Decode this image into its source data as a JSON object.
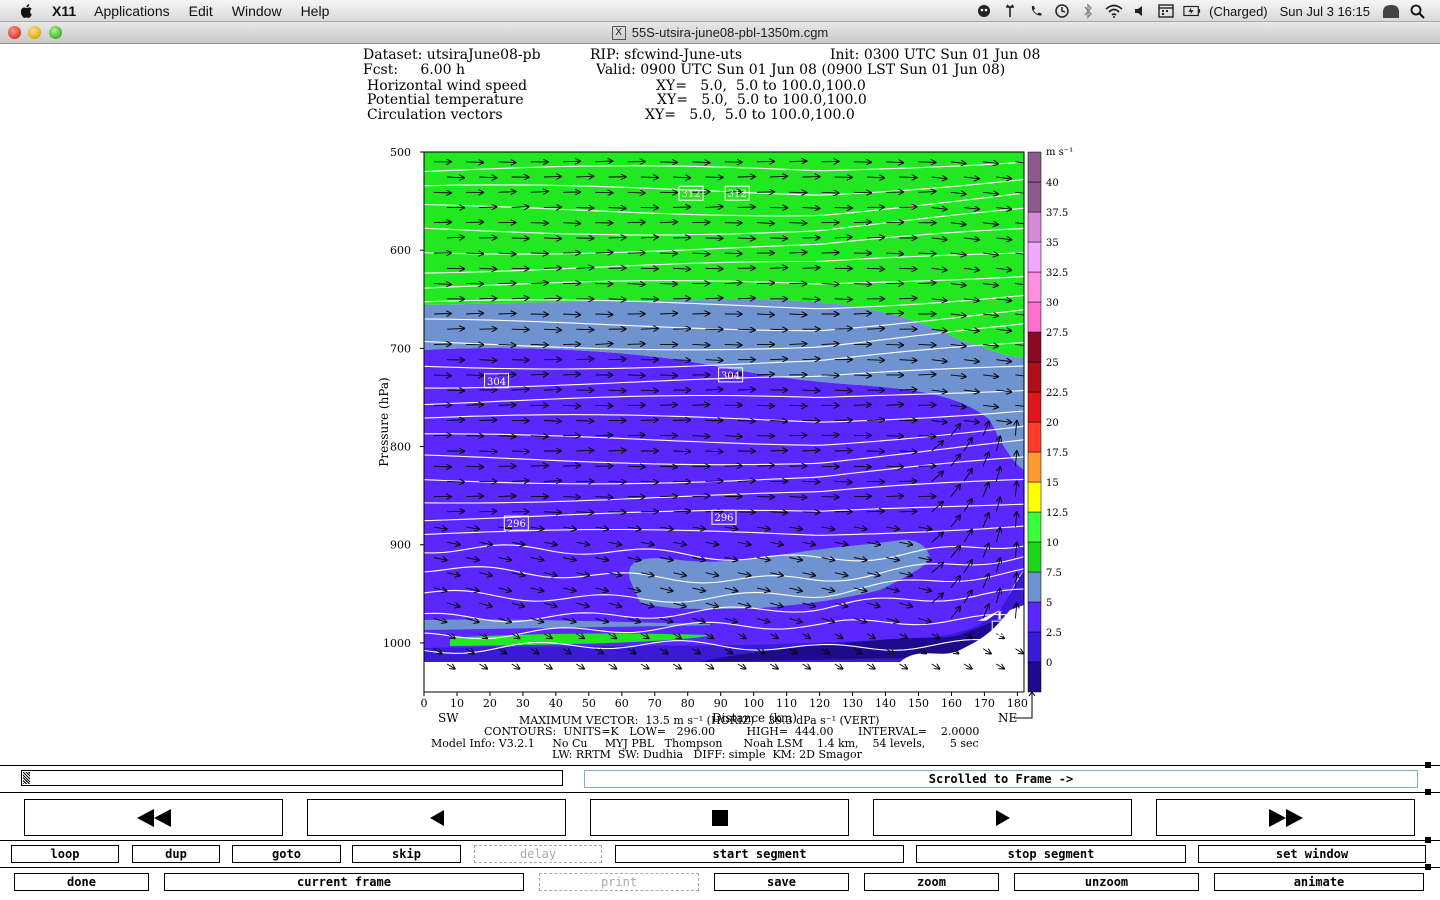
{
  "menubar": {
    "app": "X11",
    "items": [
      "Applications",
      "Edit",
      "Window",
      "Help"
    ],
    "battery": "(Charged)",
    "clock": "Sun Jul 3  16:15"
  },
  "window": {
    "title": "55S-utsira-june08-pbl-1350m.cgm"
  },
  "plot_header": {
    "line1_dataset": "Dataset: utsiraJune08-pb",
    "line1_rip": "RIP: sfcwind-June-uts",
    "line1_init": "Init: 0300 UTC Sun 01 Jun 08",
    "line2_fcst": "Fcst:     6.00 h",
    "line2_valid": "Valid: 0900 UTC Sun 01 Jun 08 (0900 LST Sun 01 Jun 08)",
    "field1": "Horizontal wind speed",
    "field2": "Potential temperature",
    "field3": "Circulation vectors",
    "xy1": "XY=   5.0,  5.0 to 100.0,100.0",
    "xy2": "XY=   5.0,  5.0 to 100.0,100.0",
    "xy3": "XY=   5.0,  5.0 to 100.0,100.0"
  },
  "chart_data": {
    "type": "heatmap",
    "ylabel": "Pressure (hPa)",
    "xlabel": "Distance (km)",
    "y_ticks": [
      500,
      600,
      700,
      800,
      900,
      1000
    ],
    "x_ticks": [
      0,
      10,
      20,
      30,
      40,
      50,
      60,
      70,
      80,
      90,
      100,
      110,
      120,
      130,
      140,
      150,
      160,
      170,
      180
    ],
    "xlim": [
      0,
      182
    ],
    "ylim": [
      1050,
      500
    ],
    "x_endpoint_left": "SW",
    "x_endpoint_right": "NE",
    "colorbar_unit": "m s⁻¹",
    "colorbar_levels": [
      "0",
      "2.5",
      "5",
      "7.5",
      "10",
      "12.5",
      "15",
      "17.5",
      "20",
      "22.5",
      "25",
      "27.5",
      "30",
      "32.5",
      "35",
      "37.5",
      "40"
    ],
    "colorbar_colors": [
      "#1e0b8c",
      "#3a1ad6",
      "#5a28ff",
      "#6f93d0",
      "#1fd61f",
      "#3cff3c",
      "#ffff00",
      "#ff9a33",
      "#ff3c2a",
      "#e0151b",
      "#b00e1b",
      "#8c0a24",
      "#ff70cc",
      "#ff8fe0",
      "#f3a8ff",
      "#d68bd9",
      "#8c5a8c"
    ],
    "contour_labels": [
      {
        "text": "312",
        "x": 81,
        "y": 542
      },
      {
        "text": "312",
        "x": 95,
        "y": 542
      },
      {
        "text": "304",
        "x": 22,
        "y": 733
      },
      {
        "text": "304",
        "x": 93,
        "y": 727
      },
      {
        "text": "296",
        "x": 28,
        "y": 878
      },
      {
        "text": "296",
        "x": 91,
        "y": 872
      },
      {
        "text": "29",
        "x": 176,
        "y": 985
      }
    ],
    "low_marker": {
      "text": "L",
      "x": 175,
      "y": 972
    }
  },
  "annotation": {
    "max_vector": "MAXIMUM VECTOR:  13.5 m s⁻¹ (HORIZ)    39.3 dPa s⁻¹ (VERT)",
    "contours": "CONTOURS:  UNITS=K   LOW=   296.00         HIGH=  444.00       INTERVAL=    2.0000",
    "model_info": "Model Info: V3.2.1     No Cu     MYJ PBL   Thompson      Noah LSM    1.4 km,    54 levels,       5 sec",
    "physics": "LW: RRTM  SW: Dudhia   DIFF: simple  KM: 2D Smagor"
  },
  "controls": {
    "frame_status": "Scrolled to Frame ->",
    "progress": 0.01,
    "row1": [
      "loop",
      "dup",
      "goto",
      "skip",
      "delay",
      "start segment",
      "stop segment",
      "set window"
    ],
    "row2": [
      "done",
      "current frame",
      "print",
      "save",
      "zoom",
      "unzoom",
      "animate"
    ]
  }
}
